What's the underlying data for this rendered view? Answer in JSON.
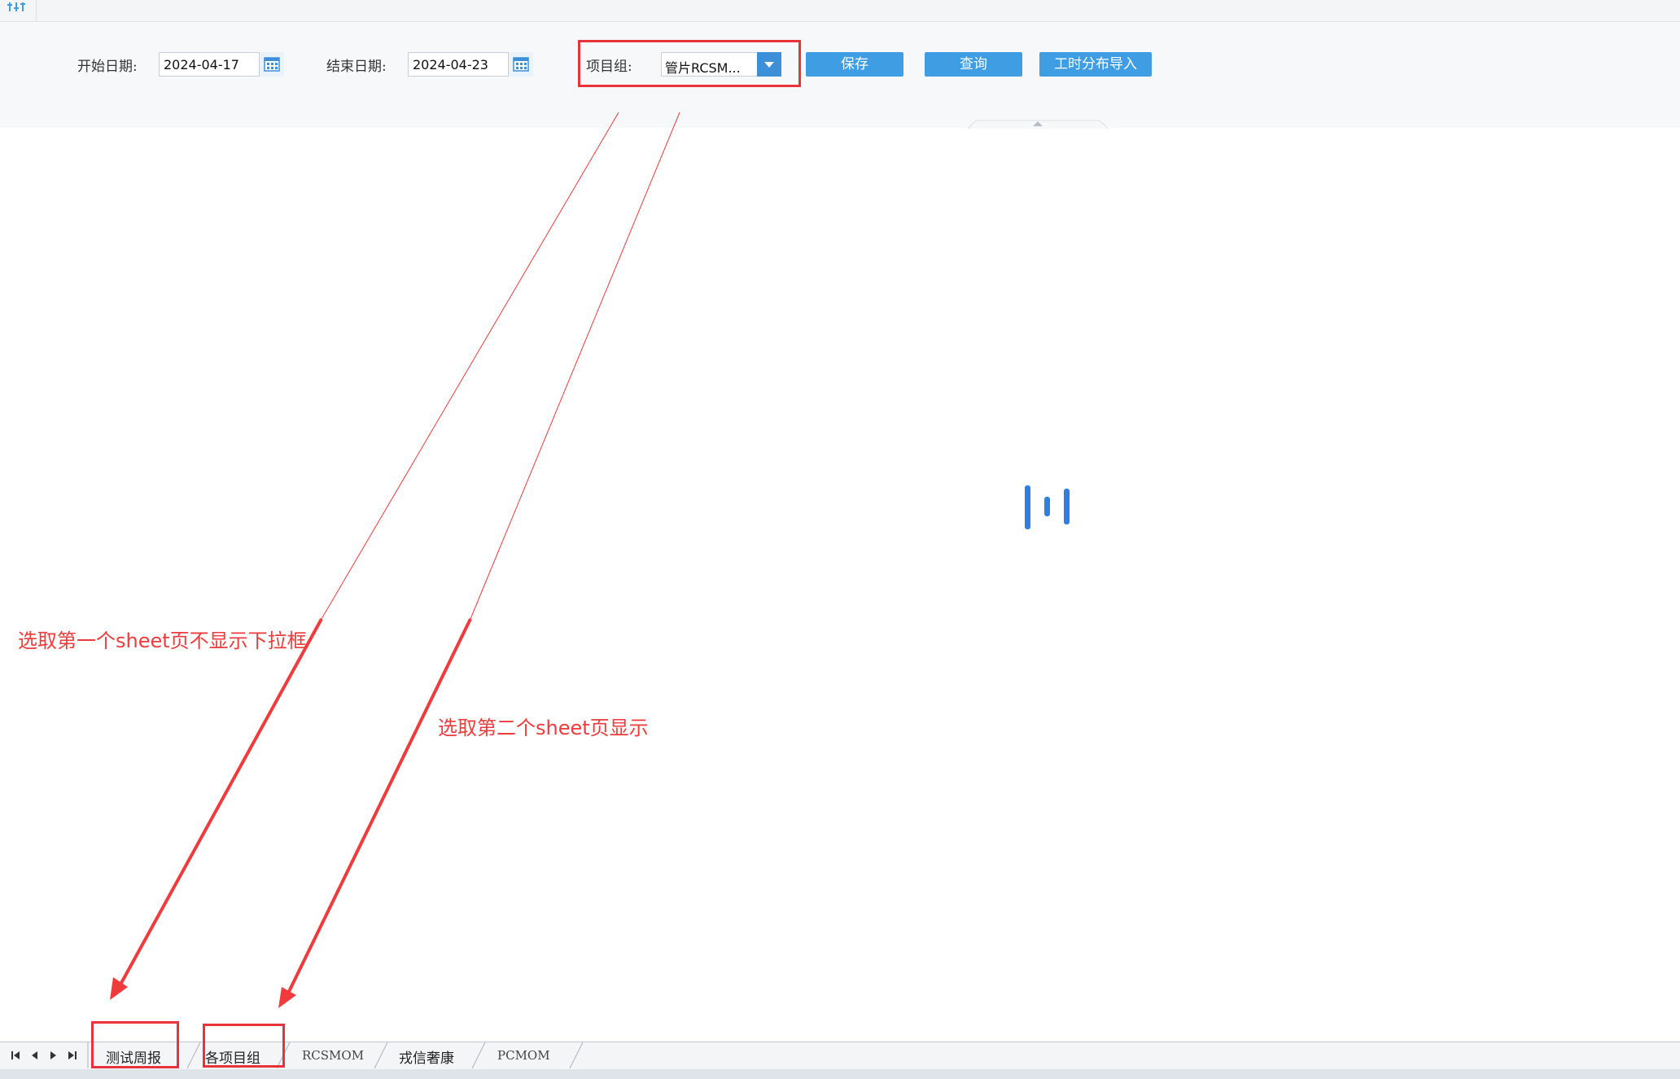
{
  "toolbar": {
    "start_label": "开始日期:",
    "start_value": "2024-04-17",
    "end_label": "结束日期:",
    "end_value": "2024-04-23",
    "group_label": "项目组:",
    "group_value": "管片RCSM...",
    "save_label": "保存",
    "query_label": "查询",
    "import_label": "工时分布导入"
  },
  "annotations": {
    "first_note": "选取第一个sheet页不显示下拉框",
    "second_note": "选取第二个sheet页显示"
  },
  "sheets": [
    {
      "label": "测试周报"
    },
    {
      "label": "各项目组"
    },
    {
      "label": "RCSMOM"
    },
    {
      "label": "戎信奢康"
    },
    {
      "label": "PCMOM"
    }
  ],
  "colors": {
    "accent": "#3f9ee3",
    "annotation": "#ef3b3b",
    "spinner": "#2f7fe0"
  }
}
